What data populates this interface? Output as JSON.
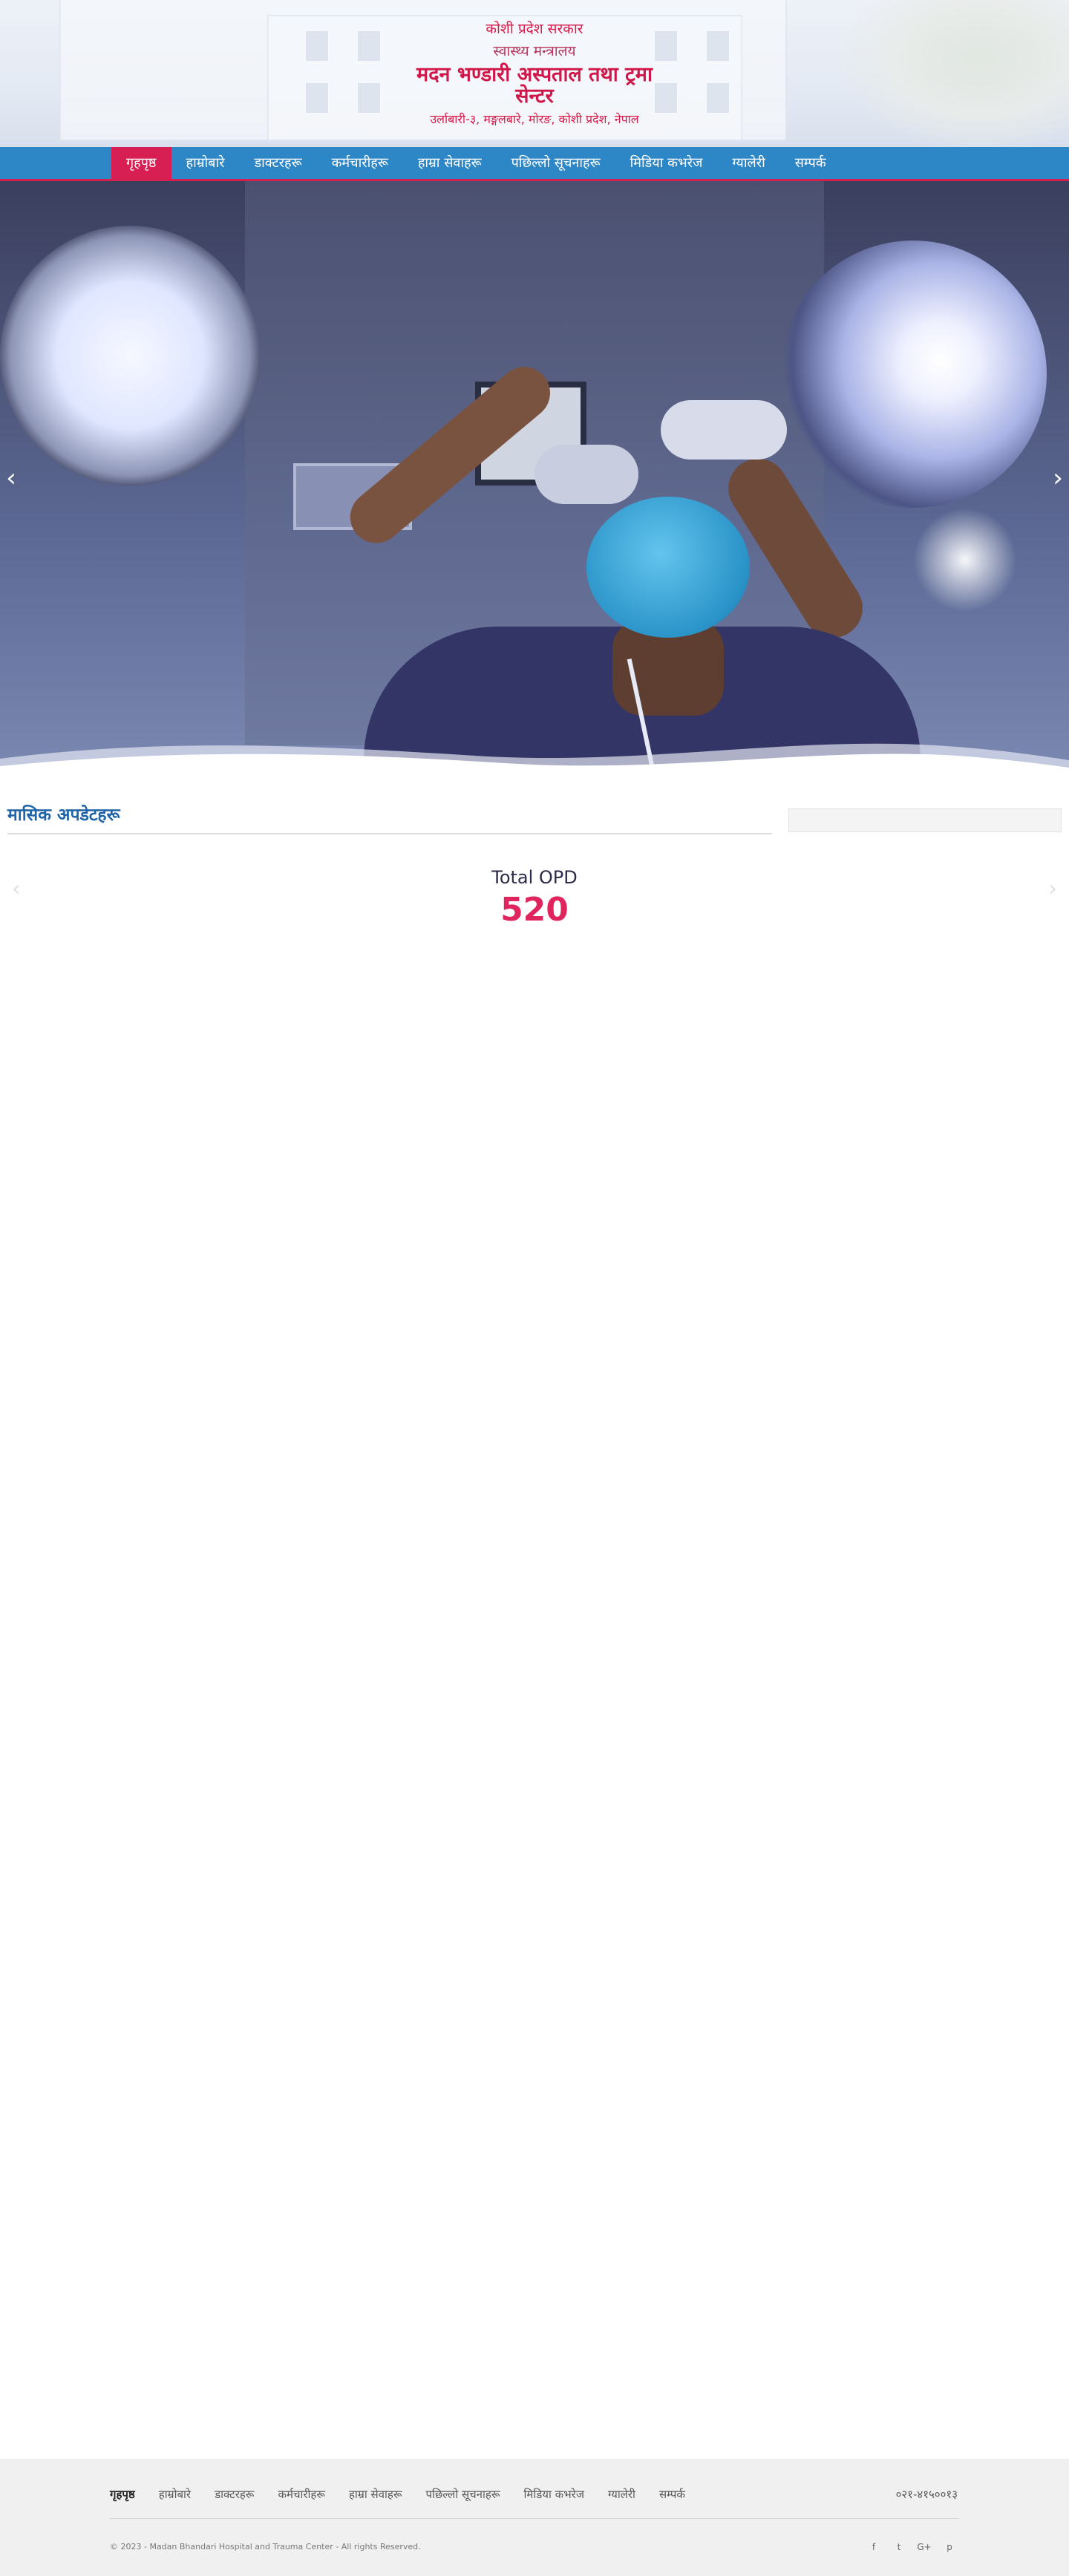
{
  "header": {
    "line1": "कोशी प्रदेश सरकार",
    "line2": "स्वास्थ्य मन्त्रालय",
    "title": "मदन भण्डारी अस्पताल तथा ट्रमा सेन्टर",
    "address": "उर्लाबारी-३, मङ्गलबारे, मोरङ, कोशी प्रदेश, नेपाल"
  },
  "nav": {
    "items": [
      {
        "label": "गृहपृष्ठ",
        "active": true
      },
      {
        "label": "हाम्रोबारे"
      },
      {
        "label": "डाक्टरहरू"
      },
      {
        "label": "कर्मचारीहरू"
      },
      {
        "label": "हाम्रा सेवाहरू"
      },
      {
        "label": "पछिल्लो सूचनाहरू"
      },
      {
        "label": "मिडिया कभरेज"
      },
      {
        "label": "ग्यालेरी"
      },
      {
        "label": "सम्पर्क"
      }
    ]
  },
  "hero": {
    "prev_icon": "chevron-left-icon",
    "next_icon": "chevron-right-icon",
    "prev_glyph": "‹",
    "next_glyph": "›"
  },
  "updates": {
    "heading": "मासिक अपडेटहरू",
    "stat_label": "Total OPD",
    "stat_value": "520",
    "prev_glyph": "‹",
    "next_glyph": "›"
  },
  "footer": {
    "items": [
      {
        "label": "गृहपृष्ठ",
        "active": true
      },
      {
        "label": "हाम्रोबारे"
      },
      {
        "label": "डाक्टरहरू"
      },
      {
        "label": "कर्मचारीहरू"
      },
      {
        "label": "हाम्रा सेवाहरू"
      },
      {
        "label": "पछिल्लो सूचनाहरू"
      },
      {
        "label": "मिडिया कभरेज"
      },
      {
        "label": "ग्यालेरी"
      },
      {
        "label": "सम्पर्क"
      }
    ],
    "phone": "०२१-४१५००१३",
    "copyright": "© 2023 - Madan Bhandari Hospital and Trauma Center - All rights Reserved.",
    "social": {
      "facebook": "f",
      "twitter": "t",
      "google": "G+",
      "pinterest": "p"
    }
  },
  "colors": {
    "nav_bg": "#2d86c6",
    "accent": "#d81f53",
    "heading_blue": "#1d65a8",
    "stat_red": "#e0245e"
  }
}
